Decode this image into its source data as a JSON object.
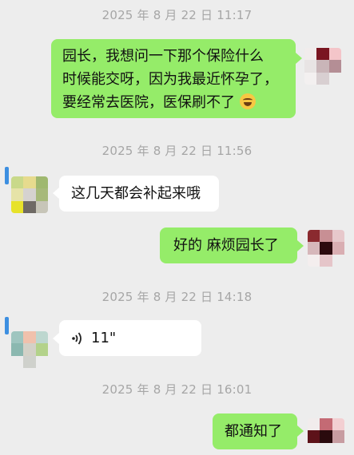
{
  "timestamps": [
    "2025 年 8 月 22 日 11:17",
    "2025 年 8 月 22 日 11:56",
    "2025 年 8 月 22 日 14:18",
    "2025 年 8 月 22 日 16:01"
  ],
  "messages": [
    {
      "side": "out",
      "lines": [
        "园长，我想问一下那个保险什么",
        "时候能交呀，因为我最近怀孕了，",
        "要经常去医院，医保刷不了"
      ],
      "emoji": "laughing-crying-emoji"
    },
    {
      "side": "in",
      "text": "这几天都会补起来哦"
    },
    {
      "side": "out",
      "text": "好的 麻烦园长了"
    },
    {
      "side": "in",
      "type": "voice",
      "duration": "11\""
    },
    {
      "side": "out",
      "text": "都通知了"
    }
  ],
  "colors": {
    "background": "#ededed",
    "outgoing_bubble": "#95ec69",
    "incoming_bubble": "#ffffff",
    "timestamp": "#a6a6a6"
  }
}
